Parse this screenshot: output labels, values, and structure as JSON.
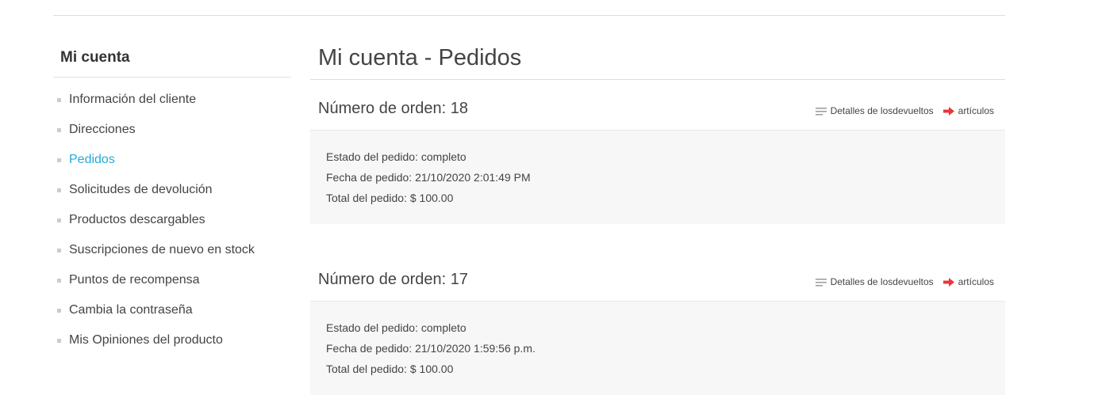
{
  "sidebar": {
    "title": "Mi cuenta",
    "items": [
      {
        "label": "Información del cliente"
      },
      {
        "label": "Direcciones"
      },
      {
        "label": "Pedidos"
      },
      {
        "label": "Solicitudes de devolución"
      },
      {
        "label": "Productos descargables"
      },
      {
        "label": "Suscripciones de nuevo en stock"
      },
      {
        "label": "Puntos de recompensa"
      },
      {
        "label": "Cambia la contraseña"
      },
      {
        "label": "Mis Opiniones del producto"
      }
    ],
    "active_item": "Pedidos"
  },
  "main": {
    "title": "Mi cuenta - Pedidos",
    "orders": [
      {
        "number": "Número de orden: 18",
        "details_label": "Detalles de losdevueltos",
        "items_label": "artículos",
        "status": "Estado del pedido: completo",
        "date": "Fecha de pedido: 21/10/2020 2:01:49 PM",
        "total": "Total del pedido: $ 100.00"
      },
      {
        "number": "Número de orden: 17",
        "details_label": "Detalles de losdevueltos",
        "items_label": "artículos",
        "status": "Estado del pedido: completo",
        "date": "Fecha de pedido: 21/10/2020 1:59:56 p.m.",
        "total": "Total del pedido: $ 100.00"
      }
    ]
  },
  "colors": {
    "active_link": "#27a9d8",
    "arrow_icon": "#e8373a",
    "order_body_bg": "#f7f7f7"
  },
  "icons": {
    "details": "lines-icon",
    "items": "arrow-right-icon"
  }
}
